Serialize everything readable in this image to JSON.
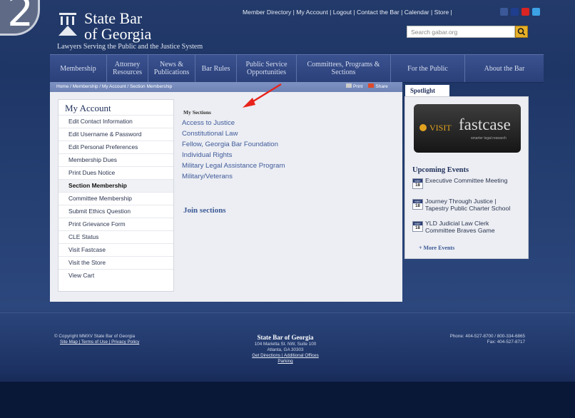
{
  "step_badge": "2",
  "header": {
    "org_line1": "State Bar",
    "org_line2": "of Georgia",
    "tagline": "Lawyers Serving the Public and the Justice System",
    "utility_links": "Member Directory | My Account | Logout | Contact the Bar | Calendar | Store |",
    "search_placeholder": "Search gabar.org",
    "social_colors": [
      "#3b5998",
      "#1f3e8e",
      "#d92424",
      "#3da1e6"
    ]
  },
  "nav": [
    {
      "label": "Membership"
    },
    {
      "label": "Attorney Resources"
    },
    {
      "label": "News & Publications"
    },
    {
      "label": "Bar Rules"
    },
    {
      "label": "Public Service Opportunities"
    },
    {
      "label": "Committees, Programs & Sections"
    },
    {
      "label": "For the Public"
    },
    {
      "label": "About the Bar"
    }
  ],
  "breadcrumb": "Home / Membership / My Account / Section Membership",
  "page_tools": {
    "print": "Print",
    "share": "Share"
  },
  "account": {
    "title": "My Account",
    "items": [
      "Edit Contact Information",
      "Edit Username & Password",
      "Edit Personal Preferences",
      "Membership Dues",
      "Print Dues Notice",
      "Section Membership",
      "Committee Membership",
      "Submit Ethics Question",
      "Print Grievance Form",
      "CLE Status",
      "Visit Fastcase",
      "Visit the Store",
      "View Cart"
    ],
    "active_index": 5
  },
  "sections": {
    "heading": "My Sections",
    "items": [
      "Access to Justice",
      "Constitutional Law",
      "Fellow, Georgia Bar Foundation",
      "Individual Rights",
      "Military Legal Assistance Program",
      "Military/Veterans"
    ],
    "join_label": "Join sections"
  },
  "spotlight": {
    "tab": "Spotlight",
    "ad_visit": "VISIT",
    "ad_name": "fastcase",
    "ad_sub": "smarter legal research",
    "events_title": "Upcoming Events",
    "events": [
      {
        "month": "MAY",
        "day": "18",
        "lines": [
          "Executive Committee Meeting"
        ]
      },
      {
        "month": "MAY",
        "day": "18",
        "lines": [
          "Journey Through Justice |",
          "Tapestry Public Charter School"
        ]
      },
      {
        "month": "MAY",
        "day": "18",
        "lines": [
          "YLD Judicial Law Clerk",
          "Committee Braves Game"
        ]
      }
    ],
    "more": "+ More Events"
  },
  "footer": {
    "copyright": "© Copyright MMXV State Bar of Georgia",
    "left_links": "Site Map | Terms of Use | Privacy Policy",
    "center_title": "State Bar of Georgia",
    "address1": "104 Marietta St. NW, Suite 100",
    "address2": "Atlanta, GA 30303",
    "directions": "Get Directions | Additional Offices",
    "parking": "Parking",
    "phone": "Phone: 404-527-8700 / 800-334-6865",
    "fax": "Fax: 404-527-8717"
  }
}
